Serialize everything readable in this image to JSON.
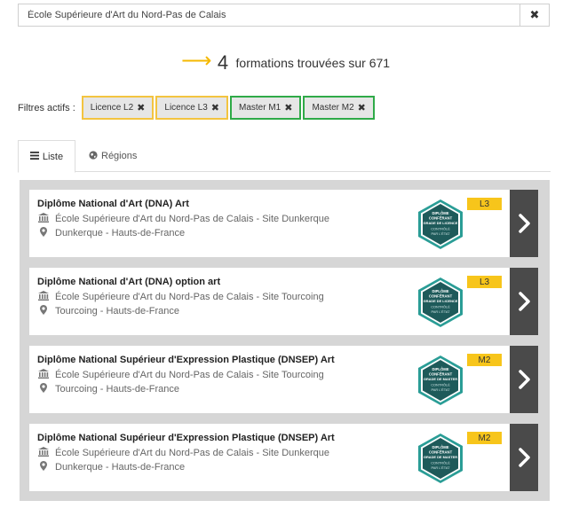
{
  "search": {
    "value": "École Supérieure d'Art du Nord-Pas de Calais",
    "clear_icon": "✖"
  },
  "results": {
    "arrow": "⟶",
    "count": "4",
    "label": "formations trouvées sur 671"
  },
  "filters": {
    "label": "Filtres actifs :",
    "remove_icon": "✖",
    "chips": [
      {
        "label": "Licence L2",
        "kind": "licence"
      },
      {
        "label": "Licence L3",
        "kind": "licence"
      },
      {
        "label": "Master M1",
        "kind": "master"
      },
      {
        "label": "Master M2",
        "kind": "master"
      }
    ]
  },
  "tabs": [
    {
      "label": "Liste",
      "icon": "list-icon",
      "active": true
    },
    {
      "label": "Régions",
      "icon": "globe-icon",
      "active": false
    }
  ],
  "colors": {
    "accent": "#f5b800",
    "licence_border": "#f3c440",
    "master_border": "#2faa48",
    "level_badge": "#f7c51b",
    "seal": "#1e5a5a"
  },
  "cards": [
    {
      "title": "Diplôme National d'Art (DNA) Art",
      "school": "École Supérieure d'Art du Nord-Pas de Calais - Site Dunkerque",
      "place": "Dunkerque - Hauts-de-France",
      "level": "L3",
      "seal": [
        "DIPLÔME",
        "CONFÉRANT",
        "GRADE DE LICENCE",
        "CONTRÔLÉ",
        "PAR L'ÉTAT"
      ]
    },
    {
      "title": "Diplôme National d'Art (DNA) option art",
      "school": "École Supérieure d'Art du Nord-Pas de Calais - Site Tourcoing",
      "place": "Tourcoing - Hauts-de-France",
      "level": "L3",
      "seal": [
        "DIPLÔME",
        "CONFÉRANT",
        "GRADE DE LICENCE",
        "CONTRÔLÉ",
        "PAR L'ÉTAT"
      ]
    },
    {
      "title": "Diplôme National Supérieur d'Expression Plastique (DNSEP) Art",
      "school": "École Supérieure d'Art du Nord-Pas de Calais - Site Tourcoing",
      "place": "Tourcoing - Hauts-de-France",
      "level": "M2",
      "seal": [
        "DIPLÔME",
        "CONFÉRANT",
        "GRADE DE MASTER",
        "CONTRÔLÉ",
        "PAR L'ÉTAT"
      ]
    },
    {
      "title": "Diplôme National Supérieur d'Expression Plastique (DNSEP) Art",
      "school": "École Supérieure d'Art du Nord-Pas de Calais - Site Dunkerque",
      "place": "Dunkerque - Hauts-de-France",
      "level": "M2",
      "seal": [
        "DIPLÔME",
        "CONFÉRANT",
        "GRADE DE MASTER",
        "CONTRÔLÉ",
        "PAR L'ÉTAT"
      ]
    }
  ]
}
